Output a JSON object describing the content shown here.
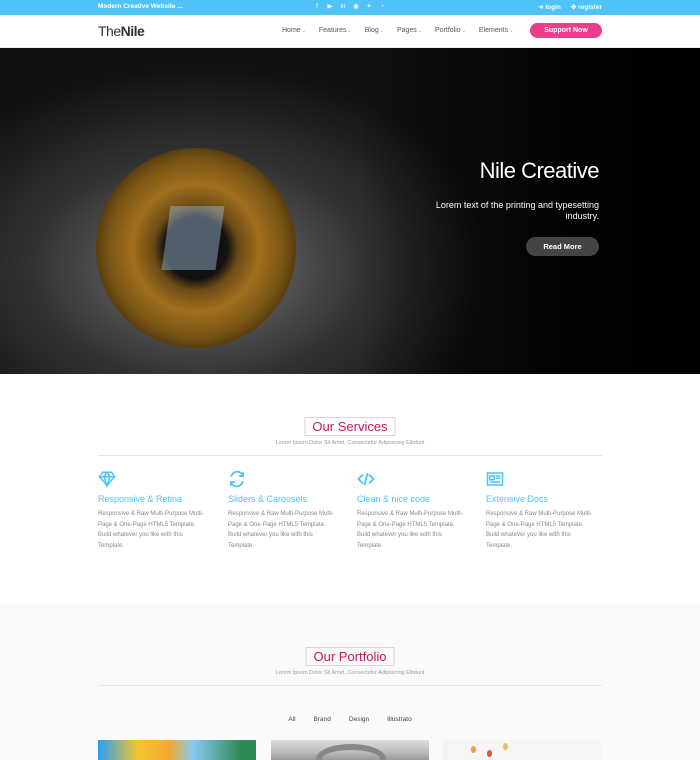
{
  "topbar": {
    "tagline": "Modern Creative Website ...",
    "socials": [
      "facebook-icon",
      "youtube-icon",
      "linkedin-icon",
      "pinterest-icon",
      "twitter-icon",
      "rss-icon"
    ],
    "login": "login",
    "register": "register"
  },
  "header": {
    "logo_light": "The",
    "logo_bold": "Nile",
    "nav": [
      {
        "label": "Home",
        "active": true
      },
      {
        "label": "Features",
        "active": false
      },
      {
        "label": "Blog",
        "active": false
      },
      {
        "label": "Pages",
        "active": false
      },
      {
        "label": "Portfolio",
        "active": false
      },
      {
        "label": "Elements",
        "active": false
      }
    ],
    "support_label": "Support Now"
  },
  "hero": {
    "title": "Nile Creative",
    "subtitle": "Lorem text of the printing and typesetting industry.",
    "button": "Read More"
  },
  "services": {
    "title": "Our Services",
    "subtitle": "Lorem Ipsum Dolor Sit Amet, Consectetur Adipisicing Elitdunt",
    "items": [
      {
        "icon": "diamond-icon",
        "title": "Responsive & Retina",
        "text": "Responsive & Raw Multi-Purpose Multi-Page & One-Page HTML5 Template. Build whatever you like with this Template."
      },
      {
        "icon": "refresh-icon",
        "title": "Sliders & Carousels",
        "text": "Responsive & Raw Multi-Purpose Multi-Page & One-Page HTML5 Template. Build whatever you like with this Template."
      },
      {
        "icon": "code-icon",
        "title": "Clean & nice code",
        "text": "Responsive & Raw Multi-Purpose Multi-Page & One-Page HTML5 Template. Build whatever you like with this Template."
      },
      {
        "icon": "newspaper-icon",
        "title": "Extensive Docs",
        "text": "Responsive & Raw Multi-Purpose Multi-Page & One-Page HTML5 Template. Build whatever you like with this Template."
      }
    ]
  },
  "portfolio": {
    "title": "Our Portfolio",
    "subtitle": "Lorem Ipsum Dolor Sit Amet, Consectetur Adipisicing Elitdunt",
    "filters": [
      "All",
      "Brand",
      "Design",
      "Illustrato"
    ]
  },
  "colors": {
    "accent": "#4fc3f7",
    "brand_pink": "#e83e8c",
    "title_pink": "#c2185b"
  }
}
